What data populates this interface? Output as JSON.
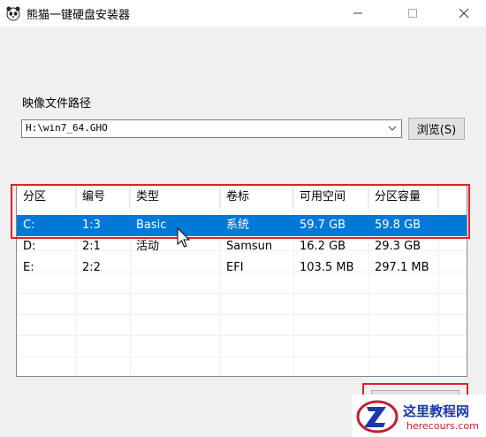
{
  "window": {
    "title": "熊猫一键硬盘安装器"
  },
  "image_path": {
    "label": "映像文件路径",
    "value": "H:\\win7_64.GHO"
  },
  "browse_button": {
    "label": "浏览(S)"
  },
  "partition_table": {
    "columns": [
      "分区",
      "编号",
      "类型",
      "卷标",
      "可用空间",
      "分区容量"
    ],
    "rows": [
      {
        "partition": "C:",
        "number": "1:3",
        "type": "Basic",
        "label": "系统",
        "free": "59.7 GB",
        "capacity": "59.8 GB",
        "selected": true
      },
      {
        "partition": "D:",
        "number": "2:1",
        "type": "活动",
        "label": "Samsun",
        "free": "16.2 GB",
        "capacity": "29.3 GB",
        "selected": false
      },
      {
        "partition": "E:",
        "number": "2:2",
        "type": "",
        "label": "EFI",
        "free": "103.5 MB",
        "capacity": "297.1 MB",
        "selected": false
      }
    ]
  },
  "watermark": {
    "title": "这里教程网",
    "url": "herecours.com"
  },
  "colors": {
    "selection": "#0078d7",
    "highlight_box": "#e0202a"
  },
  "icons": {
    "app": "panda-icon",
    "minimize": "minimize-icon",
    "maximize": "maximize-icon",
    "close": "close-icon",
    "dropdown": "chevron-down-icon"
  }
}
